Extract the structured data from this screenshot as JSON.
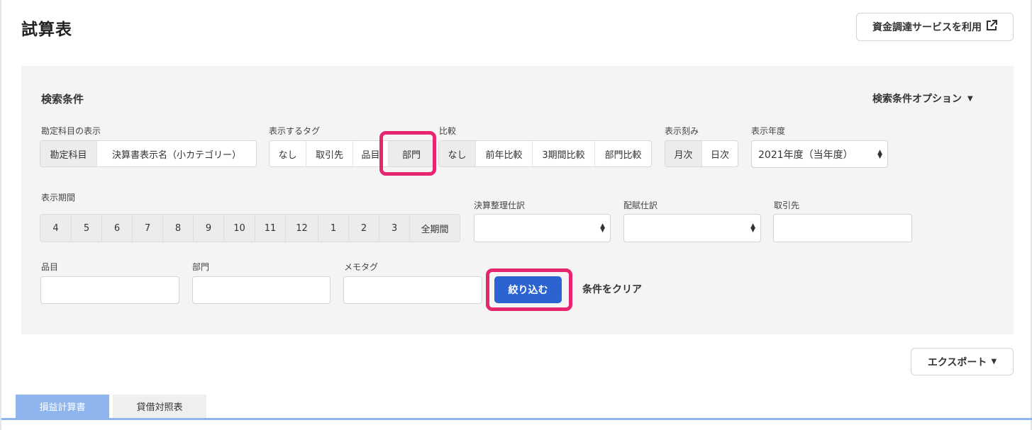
{
  "page": {
    "title": "試算表"
  },
  "header": {
    "fund_button": "資金調達サービスを利用"
  },
  "search": {
    "title": "検索条件",
    "options_label": "検索条件オプション",
    "account_display": {
      "label": "勘定科目の表示",
      "options": [
        "勘定科目",
        "決算書表示名（小カテゴリー）"
      ],
      "selected": "勘定科目"
    },
    "display_tag": {
      "label": "表示するタグ",
      "options": [
        "なし",
        "取引先",
        "品目",
        "部門"
      ],
      "selected": "部門"
    },
    "compare": {
      "label": "比較",
      "options": [
        "なし",
        "前年比較",
        "3期間比較",
        "部門比較"
      ],
      "selected": "なし"
    },
    "interval": {
      "label": "表示刻み",
      "options": [
        "月次",
        "日次"
      ],
      "selected": "月次"
    },
    "fiscal_year": {
      "label": "表示年度",
      "value": "2021年度（当年度）"
    },
    "period": {
      "label": "表示期間",
      "months": [
        "4",
        "5",
        "6",
        "7",
        "8",
        "9",
        "10",
        "11",
        "12",
        "1",
        "2",
        "3",
        "全期間"
      ]
    },
    "closing_entry": {
      "label": "決算整理仕訳",
      "value": ""
    },
    "allocation_entry": {
      "label": "配賦仕訳",
      "value": ""
    },
    "partner": {
      "label": "取引先",
      "value": ""
    },
    "item": {
      "label": "品目",
      "value": ""
    },
    "department": {
      "label": "部門",
      "value": ""
    },
    "memo_tag": {
      "label": "メモタグ",
      "value": ""
    },
    "submit_label": "絞り込む",
    "clear_label": "条件をクリア"
  },
  "export_label": "エクスポート",
  "tabs": [
    {
      "label": "損益計算書",
      "active": true
    },
    {
      "label": "貸借対照表",
      "active": false
    }
  ],
  "colors": {
    "primary": "#2b63d0",
    "highlight": "#e6266f",
    "tab_active": "#8fb5ef",
    "panel_bg": "#f5f4f4"
  }
}
